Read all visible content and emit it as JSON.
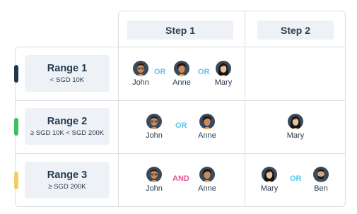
{
  "headers": {
    "step1": "Step 1",
    "step2": "Step 2"
  },
  "ranges": [
    {
      "title": "Range 1",
      "subtitle": "< SGD 10K",
      "color": "#1f3550"
    },
    {
      "title": "Range 2",
      "subtitle": "≥ SGD 10K < SGD 200K",
      "color": "#3fbf5f"
    },
    {
      "title": "Range 3",
      "subtitle": "≥ SGD 200K",
      "color": "#f1cf63"
    }
  ],
  "operators": {
    "or": "OR",
    "and": "AND",
    "or_color": "#5bc6ef",
    "and_color": "#e0549a"
  },
  "people": {
    "john": "John",
    "anne": "Anne",
    "mary": "Mary",
    "ben": "Ben"
  },
  "avatar_bg": "#3b4a5a"
}
